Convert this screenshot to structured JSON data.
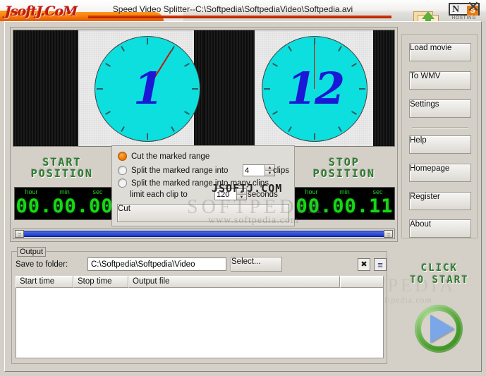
{
  "window": {
    "brand_logo": "JsoftJ.CoM",
    "title": "Speed Video Splitter--C:\\Softpedia\\SoftpediaVideo\\Softpedia.avi",
    "close_label": "✕",
    "hosting_n": "N",
    "hosting_s": "S",
    "hosting_caption": "HOSTING"
  },
  "preview": {
    "left_clock_number": "1",
    "right_clock_number": "12",
    "clock_face_color": "#0ddede",
    "clock_number_color": "#1a18d6",
    "clock_hand_color": "#c61400"
  },
  "start_position": {
    "title_line1": "START",
    "title_line2": "POSITION",
    "label_hour": "hour",
    "label_min": "min",
    "label_sec": "sec",
    "value": "00.00.00"
  },
  "stop_position": {
    "title_line1": "STOP",
    "title_line2": "POSITION",
    "label_hour": "hour",
    "label_min": "min",
    "label_sec": "sec",
    "value": "00.00.11"
  },
  "options": {
    "opt1_label": "Cut the marked range",
    "opt1_selected": true,
    "opt2_label": "Split the marked range into",
    "opt2_value": "4",
    "opt2_suffix": "clips",
    "opt3_label_line1": "Split the marked range into many clips,",
    "opt3_label_line2": "limit each clip to",
    "opt3_value": "120",
    "opt3_suffix": "seconds",
    "cut_button": "Cut",
    "spin_up": "▲",
    "spin_down": "▼"
  },
  "buttons": {
    "load_movie": "Load movie",
    "to_wmv": "To WMV",
    "settings": "Settings",
    "help": "Help",
    "homepage": "Homepage",
    "register": "Register",
    "about": "About"
  },
  "output": {
    "legend": "Output",
    "save_to_folder_label": "Save to folder:",
    "folder_path": "C:\\Softpedia\\Softpedia\\Video",
    "folder_placeholder": "C:\\",
    "select_button": "Select...",
    "clear_icon": "✖",
    "list_icon": "≡",
    "columns": [
      "Start time",
      "Stop time",
      "Output file",
      ""
    ],
    "rows": []
  },
  "start_area": {
    "line1": "CLICK",
    "line2": "TO START"
  },
  "watermarks": {
    "jsoftj": "JSOFTJ.COM",
    "softpedia": "SOFTPEDIA",
    "softpedia_url": "www.softpedia.com"
  }
}
